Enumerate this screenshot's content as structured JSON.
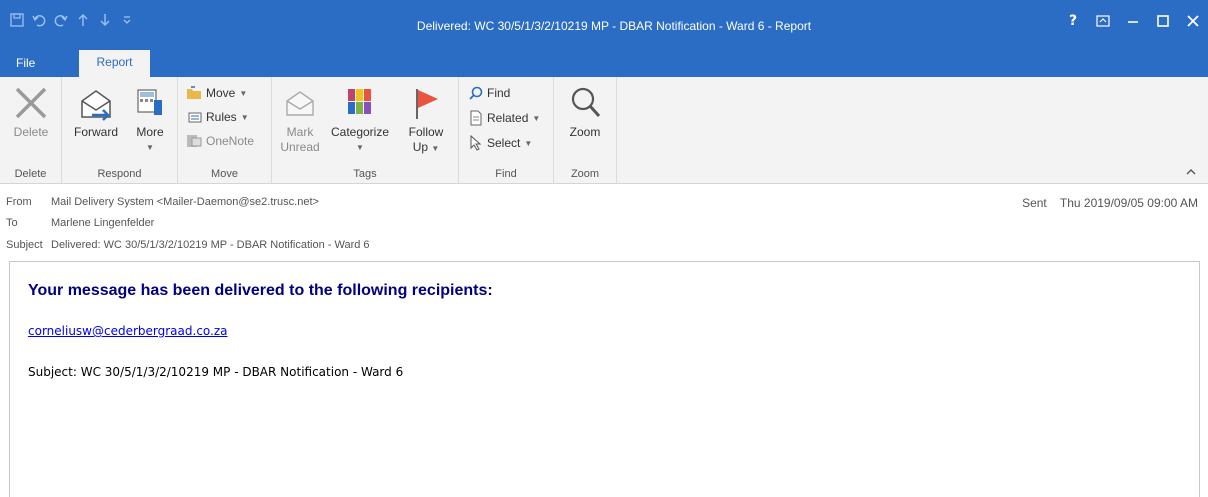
{
  "window": {
    "title": "Delivered: WC 30/5/1/3/2/10219 MP - DBAR Notification - Ward 6 - Report",
    "controls": {
      "help": "?",
      "ribbon_options": "⊡",
      "minimize": "–",
      "maximize": "☐",
      "close": "✕"
    }
  },
  "tabs": {
    "file": "File",
    "report": "Report"
  },
  "ribbon": {
    "delete_group": {
      "label": "Delete",
      "delete": "Delete"
    },
    "respond_group": {
      "label": "Respond",
      "forward": "Forward",
      "more": "More"
    },
    "move_group": {
      "label": "Move",
      "move": "Move",
      "rules": "Rules",
      "onenote": "OneNote"
    },
    "tags_group": {
      "label": "Tags",
      "mark_unread_1": "Mark",
      "mark_unread_2": "Unread",
      "categorize": "Categorize",
      "follow_up_1": "Follow",
      "follow_up_2": "Up"
    },
    "find_group": {
      "label": "Find",
      "find": "Find",
      "related": "Related",
      "select": "Select"
    },
    "zoom_group": {
      "label": "Zoom",
      "zoom": "Zoom"
    }
  },
  "header": {
    "from_label": "From",
    "from_value": "Mail Delivery System <Mailer-Daemon@se2.trusc.net>",
    "to_label": "To",
    "to_value": "Marlene Lingenfelder",
    "subject_label": "Subject",
    "subject_value": "Delivered: WC 30/5/1/3/2/10219 MP - DBAR Notification - Ward 6",
    "sent_label": "Sent",
    "sent_value": "Thu 2019/09/05 09:00 AM"
  },
  "body": {
    "heading": "Your message has been delivered to the following recipients:",
    "recipient": "corneliusw@cederbergraad.co.za",
    "subject_line": "Subject: WC 30/5/1/3/2/10219 MP - DBAR Notification - Ward 6"
  },
  "colors": {
    "accent": "#2b6cc4",
    "ribbon_bg": "#f3f3f3",
    "heading": "#000080",
    "link": "#0000ee",
    "flag": "#e8543f"
  }
}
